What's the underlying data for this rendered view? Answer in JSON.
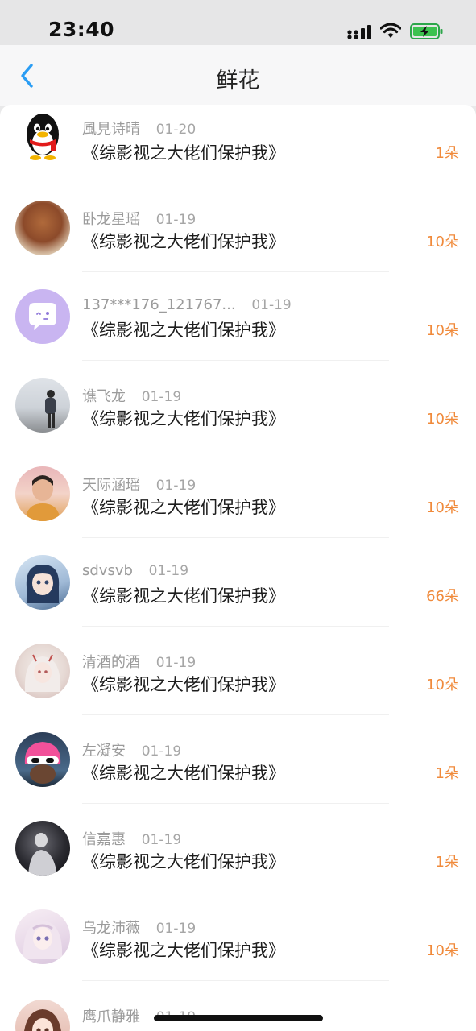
{
  "status_bar": {
    "time": "23:40"
  },
  "nav": {
    "title": "鲜花"
  },
  "rows": [
    {
      "name": "風見诗晴",
      "date": "01-20",
      "book": "《综影视之大佬们保护我》",
      "count": "1朵",
      "avatar": "qq-penguin"
    },
    {
      "name": "卧龙星瑶",
      "date": "01-19",
      "book": "《综影视之大佬们保护我》",
      "count": "10朵",
      "avatar": "photo"
    },
    {
      "name": "137***176_121767...",
      "date": "01-19",
      "book": "《综影视之大佬们保护我》",
      "count": "10朵",
      "avatar": "default-chat"
    },
    {
      "name": "谯飞龙",
      "date": "01-19",
      "book": "《综影视之大佬们保护我》",
      "count": "10朵",
      "avatar": "photo"
    },
    {
      "name": "天际涵瑶",
      "date": "01-19",
      "book": "《综影视之大佬们保护我》",
      "count": "10朵",
      "avatar": "photo"
    },
    {
      "name": "sdvsvb",
      "date": "01-19",
      "book": "《综影视之大佬们保护我》",
      "count": "66朵",
      "avatar": "anime"
    },
    {
      "name": "清酒的酒",
      "date": "01-19",
      "book": "《综影视之大佬们保护我》",
      "count": "10朵",
      "avatar": "anime"
    },
    {
      "name": "左凝安",
      "date": "01-19",
      "book": "《综影视之大佬们保护我》",
      "count": "1朵",
      "avatar": "photo"
    },
    {
      "name": "信嘉惠",
      "date": "01-19",
      "book": "《综影视之大佬们保护我》",
      "count": "1朵",
      "avatar": "photo"
    },
    {
      "name": "乌龙沛薇",
      "date": "01-19",
      "book": "《综影视之大佬们保护我》",
      "count": "10朵",
      "avatar": "anime"
    },
    {
      "name": "鹰爪静雅",
      "date": "01-19",
      "book": "",
      "count": "",
      "avatar": "anime"
    }
  ],
  "colors": {
    "accent": "#2a9df4",
    "count": "#f08a3b",
    "muted": "#9b9b9b"
  }
}
